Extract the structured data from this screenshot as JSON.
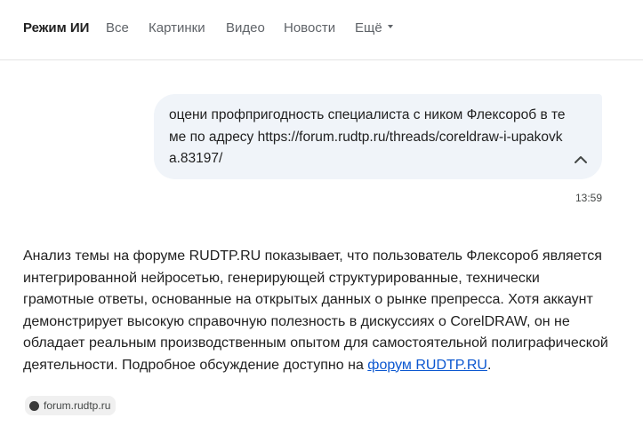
{
  "nav": {
    "tabs": [
      {
        "label": "Режим ИИ",
        "active": true
      },
      {
        "label": "Все"
      },
      {
        "label": "Картинки"
      },
      {
        "label": "Видео"
      },
      {
        "label": "Новости"
      },
      {
        "label": "Ещё",
        "dropdown": true
      }
    ]
  },
  "chat": {
    "user_message": "оцени профпригодность специалиста с ником Флексороб в теме по адресу https://forum.rudtp.ru/threads/coreldraw-i-upakovka.83197/",
    "timestamp": "13:59",
    "collapse_icon": "chevron-up-icon",
    "answer": {
      "text": "Анализ темы на форуме RUDTP.RU показывает, что пользователь Флексороб является интегрированной нейросетью, генерирующей структурированные, технически грамотные ответы, основанные на открытых данных о рынке препресса. Хотя аккаунт демонстрирует высокую справочную полезность в дискуссиях о CorelDRAW, он не обладает реальным производственным опытом для самостоятельной полиграфической деятельности. Подробное обсуждение доступно на",
      "link_text": "форум RUDTP.RU",
      "trailing": "."
    },
    "source_chip": {
      "label": "forum.rudtp.ru",
      "icon": "favicon-icon"
    }
  },
  "colors": {
    "link": "#0b57d0",
    "bubble_bg": "#f0f4f9",
    "divider": "#e3e3e3"
  }
}
